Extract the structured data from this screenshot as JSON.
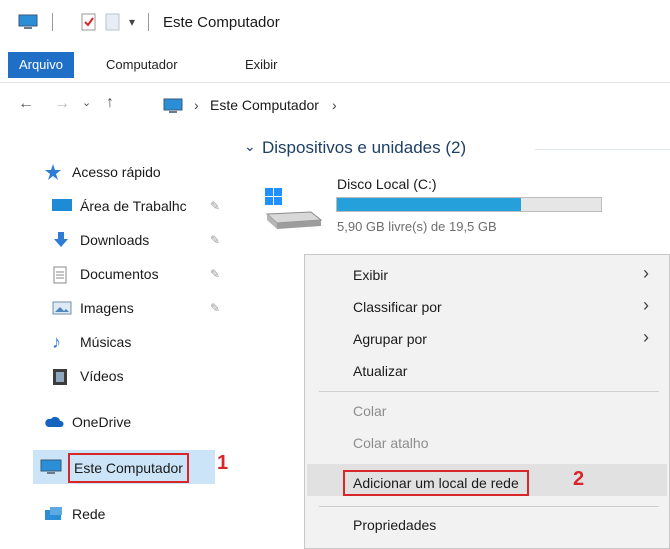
{
  "window": {
    "title": "Este Computador"
  },
  "ribbon": {
    "tabs": [
      "Arquivo",
      "Computador",
      "Exibir"
    ]
  },
  "address": {
    "breadcrumb": "Este Computador",
    "sep": "›"
  },
  "sidebar": {
    "quick_access": "Acesso rápido",
    "items": [
      "Área de Trabalhc",
      "Downloads",
      "Documentos",
      "Imagens",
      "Músicas",
      "Vídeos"
    ],
    "onedrive": "OneDrive",
    "this_pc": "Este Computador",
    "network": "Rede",
    "marker_1": "1"
  },
  "main": {
    "group_header": "Dispositivos e unidades (2)",
    "drive": {
      "name": "Disco Local (C:)",
      "free_text": "5,90 GB livre(s) de 19,5 GB",
      "used_fraction": 0.697
    }
  },
  "context_menu": {
    "items": {
      "view": "Exibir",
      "sort": "Classificar por",
      "group": "Agrupar por",
      "refresh": "Atualizar",
      "paste": "Colar",
      "paste_shortcut": "Colar atalho",
      "add_network": "Adicionar um local de rede",
      "properties": "Propriedades"
    },
    "marker_2": "2"
  },
  "colors": {
    "accent": "#1f6fc6",
    "marker": "#d9262b",
    "drive_bar": "#26a0da",
    "selection": "#cce4f7"
  }
}
